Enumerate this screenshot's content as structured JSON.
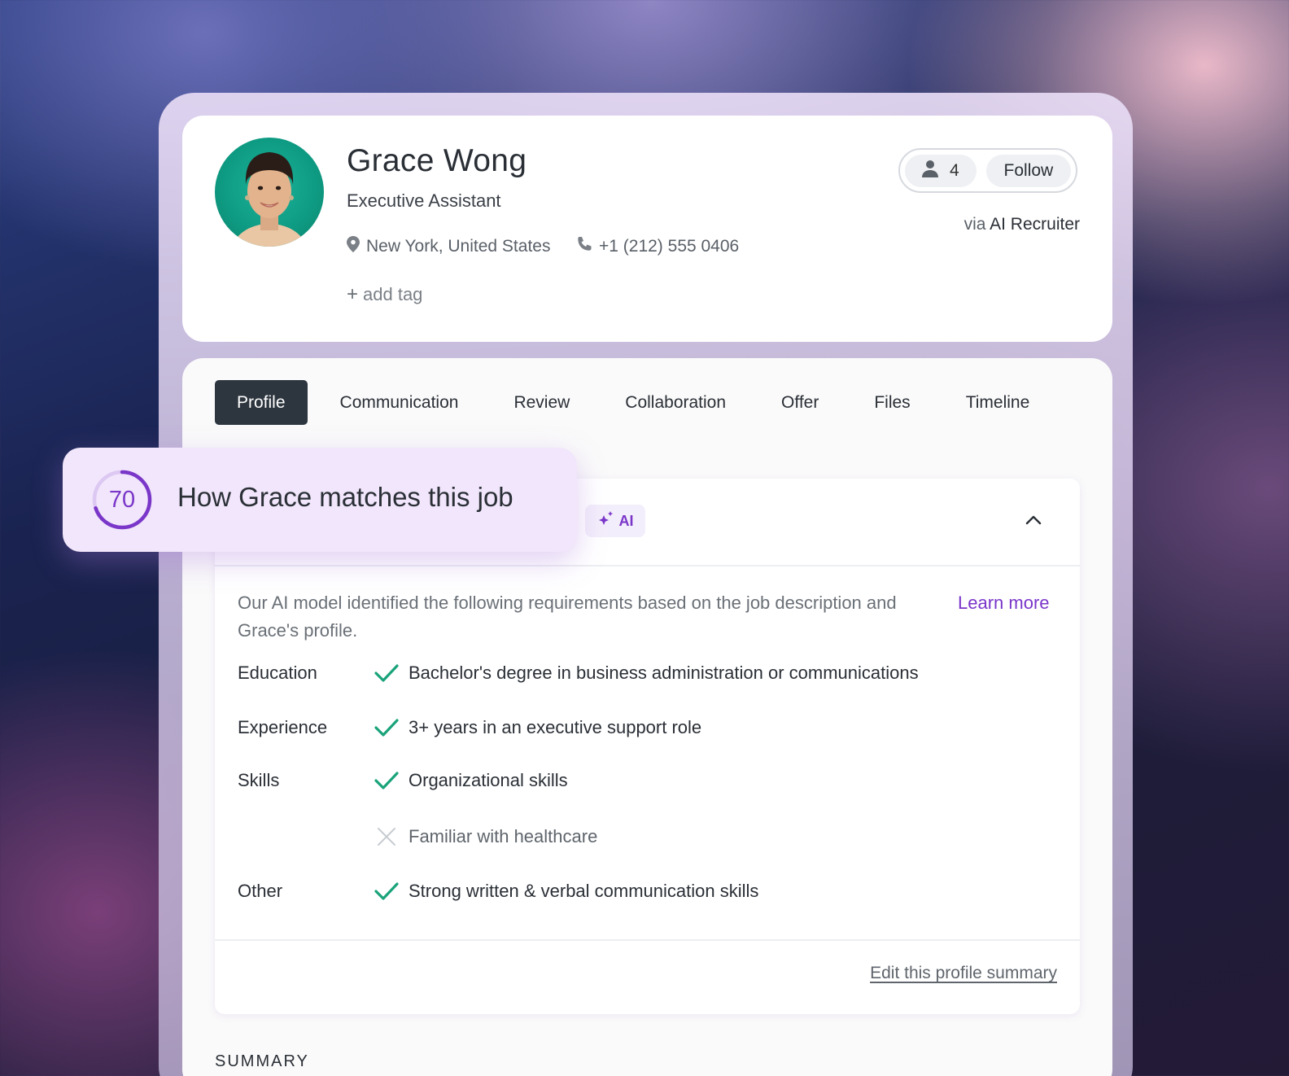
{
  "candidate": {
    "name": "Grace Wong",
    "title": "Executive Assistant",
    "location": "New York, United States",
    "phone": "+1 (212) 555 0406",
    "add_tag": "add tag",
    "followers_count": "4",
    "follow_label": "Follow",
    "via_prefix": "via",
    "source": "AI Recruiter"
  },
  "tabs": [
    {
      "label": "Profile",
      "active": true
    },
    {
      "label": "Communication",
      "active": false
    },
    {
      "label": "Review",
      "active": false
    },
    {
      "label": "Collaboration",
      "active": false
    },
    {
      "label": "Offer",
      "active": false
    },
    {
      "label": "Files",
      "active": false
    },
    {
      "label": "Timeline",
      "active": false
    }
  ],
  "match": {
    "score": "70",
    "score_fraction": 0.7,
    "title": "How Grace matches this job",
    "ai_badge": "AI",
    "intro": "Our AI model identified the following requirements based on the job description and Grace's profile.",
    "learn_more": "Learn more",
    "requirements": [
      {
        "category": "Education",
        "text": "Bachelor's degree in business administration or communications",
        "met": true
      },
      {
        "category": "Experience",
        "text": "3+ years in an executive support role",
        "met": true
      },
      {
        "category": "Skills",
        "text": "Organizational skills",
        "met": true
      },
      {
        "category": "",
        "text": "Familiar with healthcare",
        "met": false
      },
      {
        "category": "Other",
        "text": "Strong written & verbal communication skills",
        "met": true
      }
    ],
    "edit_link": "Edit this profile summary"
  },
  "summary_label": "SUMMARY",
  "colors": {
    "accent": "#7a36c9",
    "check": "#1aa37a",
    "tab_active_bg": "#2d353e",
    "avatar_bg": "#0e9a82"
  },
  "icons": [
    "location-pin-icon",
    "phone-icon",
    "plus-icon",
    "person-icon",
    "sparkle-icon",
    "chevron-up-icon",
    "check-icon",
    "cross-icon"
  ]
}
